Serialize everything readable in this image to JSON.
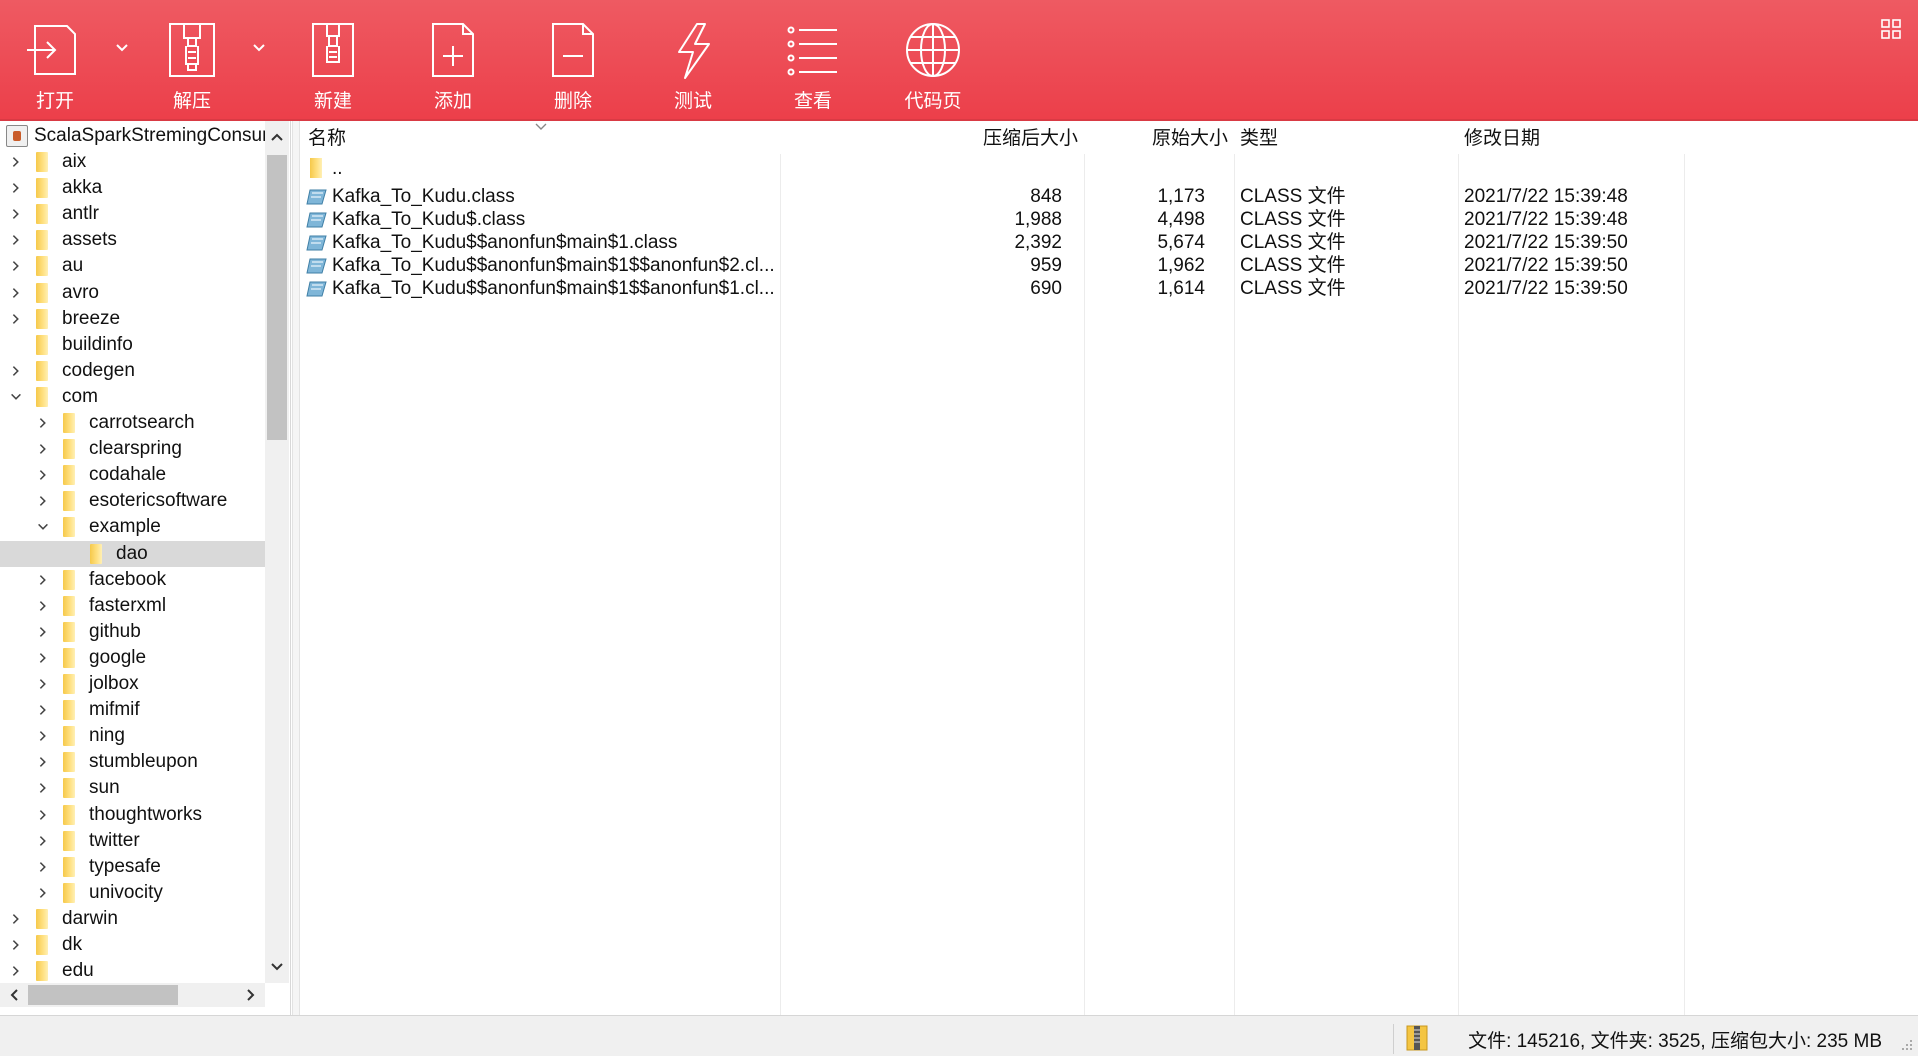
{
  "toolbar": {
    "buttons": [
      {
        "label": "打开",
        "icon": "open-icon"
      },
      {
        "label": "解压",
        "icon": "extract-icon"
      },
      {
        "label": "新建",
        "icon": "new-archive-icon"
      },
      {
        "label": "添加",
        "icon": "add-file-icon"
      },
      {
        "label": "删除",
        "icon": "delete-file-icon"
      },
      {
        "label": "测试",
        "icon": "test-icon"
      },
      {
        "label": "查看",
        "icon": "view-list-icon"
      },
      {
        "label": "代码页",
        "icon": "codepage-globe-icon"
      }
    ],
    "colors": {
      "bar": "#ec3f4a",
      "icon_stroke": "#ffffff"
    }
  },
  "tree": {
    "root": "ScalaSparkStremingConsur",
    "items": [
      {
        "name": "aix",
        "depth": 0,
        "state": "collapsed"
      },
      {
        "name": "akka",
        "depth": 0,
        "state": "collapsed"
      },
      {
        "name": "antlr",
        "depth": 0,
        "state": "collapsed"
      },
      {
        "name": "assets",
        "depth": 0,
        "state": "collapsed"
      },
      {
        "name": "au",
        "depth": 0,
        "state": "collapsed"
      },
      {
        "name": "avro",
        "depth": 0,
        "state": "collapsed"
      },
      {
        "name": "breeze",
        "depth": 0,
        "state": "collapsed"
      },
      {
        "name": "buildinfo",
        "depth": 0,
        "state": "leaf"
      },
      {
        "name": "codegen",
        "depth": 0,
        "state": "collapsed"
      },
      {
        "name": "com",
        "depth": 0,
        "state": "expanded"
      },
      {
        "name": "carrotsearch",
        "depth": 1,
        "state": "collapsed"
      },
      {
        "name": "clearspring",
        "depth": 1,
        "state": "collapsed"
      },
      {
        "name": "codahale",
        "depth": 1,
        "state": "collapsed"
      },
      {
        "name": "esotericsoftware",
        "depth": 1,
        "state": "collapsed"
      },
      {
        "name": "example",
        "depth": 1,
        "state": "expanded"
      },
      {
        "name": "dao",
        "depth": 2,
        "state": "leaf",
        "selected": true
      },
      {
        "name": "facebook",
        "depth": 1,
        "state": "collapsed"
      },
      {
        "name": "fasterxml",
        "depth": 1,
        "state": "collapsed"
      },
      {
        "name": "github",
        "depth": 1,
        "state": "collapsed"
      },
      {
        "name": "google",
        "depth": 1,
        "state": "collapsed"
      },
      {
        "name": "jolbox",
        "depth": 1,
        "state": "collapsed"
      },
      {
        "name": "mifmif",
        "depth": 1,
        "state": "collapsed"
      },
      {
        "name": "ning",
        "depth": 1,
        "state": "collapsed"
      },
      {
        "name": "stumbleupon",
        "depth": 1,
        "state": "collapsed"
      },
      {
        "name": "sun",
        "depth": 1,
        "state": "collapsed"
      },
      {
        "name": "thoughtworks",
        "depth": 1,
        "state": "collapsed"
      },
      {
        "name": "twitter",
        "depth": 1,
        "state": "collapsed"
      },
      {
        "name": "typesafe",
        "depth": 1,
        "state": "collapsed"
      },
      {
        "name": "univocity",
        "depth": 1,
        "state": "collapsed"
      },
      {
        "name": "darwin",
        "depth": 0,
        "state": "collapsed"
      },
      {
        "name": "dk",
        "depth": 0,
        "state": "collapsed"
      },
      {
        "name": "edu",
        "depth": 0,
        "state": "collapsed"
      }
    ]
  },
  "list": {
    "columns": {
      "name": "名称",
      "packed": "压缩后大小",
      "size": "原始大小",
      "type": "类型",
      "modified": "修改日期"
    },
    "up_label": "..",
    "rows": [
      {
        "name": "Kafka_To_Kudu.class",
        "packed": "848",
        "size": "1,173",
        "type": "CLASS 文件",
        "modified": "2021/7/22 15:39:48"
      },
      {
        "name": "Kafka_To_Kudu$.class",
        "packed": "1,988",
        "size": "4,498",
        "type": "CLASS 文件",
        "modified": "2021/7/22 15:39:48"
      },
      {
        "name": "Kafka_To_Kudu$$anonfun$main$1.class",
        "packed": "2,392",
        "size": "5,674",
        "type": "CLASS 文件",
        "modified": "2021/7/22 15:39:50"
      },
      {
        "name": "Kafka_To_Kudu$$anonfun$main$1$$anonfun$2.cl...",
        "packed": "959",
        "size": "1,962",
        "type": "CLASS 文件",
        "modified": "2021/7/22 15:39:50"
      },
      {
        "name": "Kafka_To_Kudu$$anonfun$main$1$$anonfun$1.cl...",
        "packed": "690",
        "size": "1,614",
        "type": "CLASS 文件",
        "modified": "2021/7/22 15:39:50"
      }
    ]
  },
  "status": {
    "text": "文件: 145216, 文件夹: 3525, 压缩包大小: 235 MB"
  }
}
